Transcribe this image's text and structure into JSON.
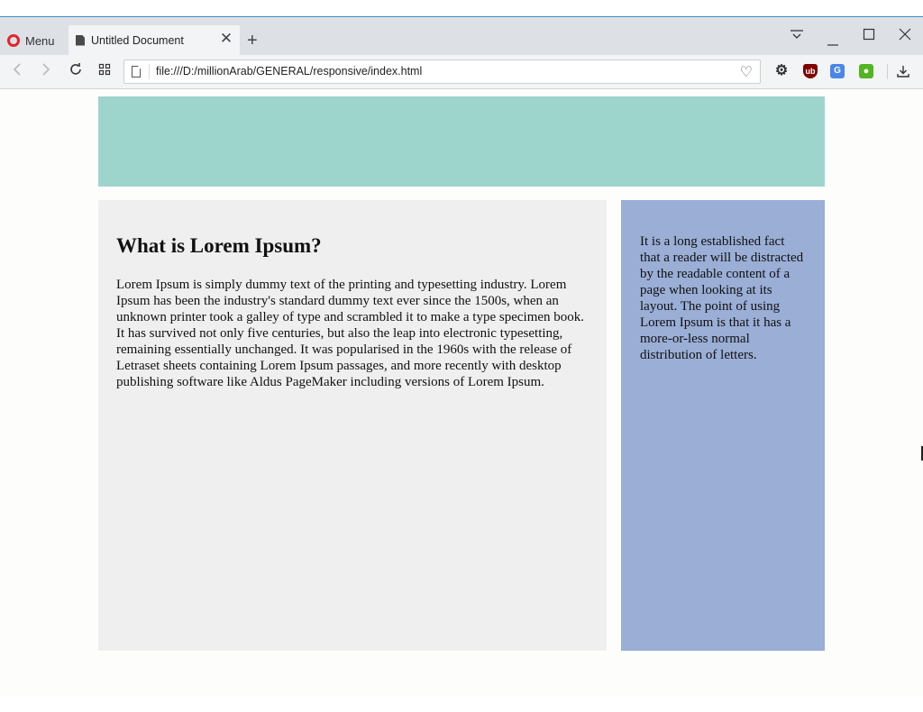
{
  "browser": {
    "menu_label": "Menu",
    "tab_title": "Untitled Document",
    "new_tab": "+",
    "url": "file:///D:/millionArab/GENERAL/responsive/index.html"
  },
  "page": {
    "heading": "What is Lorem Ipsum?",
    "main_paragraph": "Lorem Ipsum is simply dummy text of the printing and typesetting industry. Lorem Ipsum has been the industry's standard dummy text ever since the 1500s, when an unknown printer took a galley of type and scrambled it to make a type specimen book. It has survived not only five centuries, but also the leap into electronic typesetting, remaining essentially unchanged. It was popularised in the 1960s with the release of Letraset sheets containing Lorem Ipsum passages, and more recently with desktop publishing software like Aldus PageMaker including versions of Lorem Ipsum.",
    "side_paragraph": "It is a long established fact that a reader will be distracted by the readable content of a page when looking at its layout. The point of using Lorem Ipsum is that it has a more-or-less normal distribution of letters."
  },
  "colors": {
    "header": "#9dd5cd",
    "main": "#f0eff0",
    "sidebar": "#9aaed6",
    "opera_red": "#e0262c"
  },
  "icons": [
    "opera-logo-icon",
    "document-icon",
    "close-icon",
    "menu-filter-icon",
    "minimize-icon",
    "maximize-icon",
    "back-icon",
    "forward-icon",
    "reload-icon",
    "speed-dial-icon",
    "page-icon",
    "heart-icon",
    "settings-icon",
    "ublock-icon",
    "translate-icon",
    "extension-icon",
    "download-icon"
  ]
}
